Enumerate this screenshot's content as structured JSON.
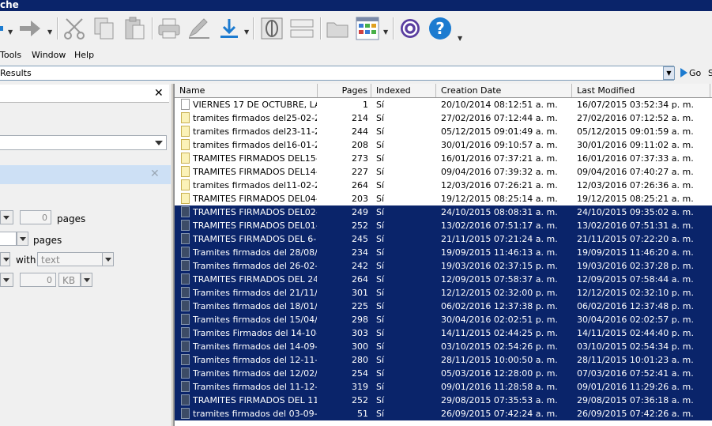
{
  "window": {
    "title_fragment": "che"
  },
  "menu": [
    "Tools",
    "Window",
    "Help"
  ],
  "address": {
    "value": "Results",
    "go_label": "Go",
    "go_cut": "S"
  },
  "left_panel": {
    "pages_label_1": "pages",
    "pages_value_1": "0",
    "pages_label_2": "pages",
    "with_label": "with",
    "text_placeholder": "text",
    "size_value": "0",
    "size_unit": "KB"
  },
  "table": {
    "columns": [
      "Name",
      "Pages",
      "Indexed",
      "Creation Date",
      "Last Modified"
    ],
    "rows": [
      {
        "icon": "white",
        "selected": false,
        "name": "VIERNES 17 DE OCTUBRE, LA...",
        "pages": "1",
        "indexed": "Sí",
        "created": "20/10/2014 08:12:51 a. m.",
        "modified": "16/07/2015 03:52:34 p. m."
      },
      {
        "icon": "yellow",
        "selected": false,
        "name": "tramites firmados del25-02-2...",
        "pages": "214",
        "indexed": "Sí",
        "created": "27/02/2016 07:12:44 a. m.",
        "modified": "27/02/2016 07:12:52 a. m."
      },
      {
        "icon": "yellow",
        "selected": false,
        "name": "tramites firmados del23-11-2...",
        "pages": "244",
        "indexed": "Sí",
        "created": "05/12/2015 09:01:49 a. m.",
        "modified": "05/12/2015 09:01:59 a. m."
      },
      {
        "icon": "yellow",
        "selected": false,
        "name": "tramites firmados del16-01-2...",
        "pages": "208",
        "indexed": "Sí",
        "created": "30/01/2016 09:10:57 a. m.",
        "modified": "30/01/2016 09:11:02 a. m."
      },
      {
        "icon": "yellow",
        "selected": false,
        "name": "TRAMITES FIRMADOS DEL15-...",
        "pages": "273",
        "indexed": "Sí",
        "created": "16/01/2016 07:37:21 a. m.",
        "modified": "16/01/2016 07:37:33 a. m."
      },
      {
        "icon": "yellow",
        "selected": false,
        "name": "TRAMITES FIRMADOS DEL14-...",
        "pages": "227",
        "indexed": "Sí",
        "created": "09/04/2016 07:39:32 a. m.",
        "modified": "09/04/2016 07:40:27 a. m."
      },
      {
        "icon": "yellow",
        "selected": false,
        "name": "tramites firmados del11-02-2...",
        "pages": "264",
        "indexed": "Sí",
        "created": "12/03/2016 07:26:21 a. m.",
        "modified": "12/03/2016 07:26:36 a. m."
      },
      {
        "icon": "yellow",
        "selected": false,
        "name": "TRAMITES FIRMADOS DEL04-...",
        "pages": "203",
        "indexed": "Sí",
        "created": "19/12/2015 08:25:14 a. m.",
        "modified": "19/12/2015 08:25:21 a. m."
      },
      {
        "icon": "sel",
        "selected": true,
        "name": "TRAMITES FIRMADOS DEL02-...",
        "pages": "249",
        "indexed": "Sí",
        "created": "24/10/2015 08:08:31 a. m.",
        "modified": "24/10/2015 09:35:02 a. m."
      },
      {
        "icon": "sel",
        "selected": true,
        "name": "TRAMITES FIRMADOS DEL01-...",
        "pages": "252",
        "indexed": "Sí",
        "created": "13/02/2016 07:51:17 a. m.",
        "modified": "13/02/2016 07:51:31 a. m."
      },
      {
        "icon": "sel",
        "selected": true,
        "name": "TRAMITES FIRMADOS DEL 6-...",
        "pages": "245",
        "indexed": "Sí",
        "created": "21/11/2015 07:21:24 a. m.",
        "modified": "21/11/2015 07:22:20 a. m."
      },
      {
        "icon": "sel",
        "selected": true,
        "name": "Tramites firmados del 28/08/2...",
        "pages": "234",
        "indexed": "Sí",
        "created": "19/09/2015 11:46:13 a. m.",
        "modified": "19/09/2015 11:46:20 a. m."
      },
      {
        "icon": "sel",
        "selected": true,
        "name": "Tramites firmados del 26-02-2...",
        "pages": "242",
        "indexed": "Sí",
        "created": "19/03/2016 02:37:15 p. m.",
        "modified": "19/03/2016 02:37:28 p. m."
      },
      {
        "icon": "sel",
        "selected": true,
        "name": "TRAMITES FIRMADOS DEL 24...",
        "pages": "264",
        "indexed": "Sí",
        "created": "12/09/2015 07:58:37 a. m.",
        "modified": "12/09/2015 07:58:44 a. m."
      },
      {
        "icon": "sel",
        "selected": true,
        "name": "Tramites firmados del 21/11/2...",
        "pages": "301",
        "indexed": "Sí",
        "created": "12/12/2015 02:32:00 p. m.",
        "modified": "12/12/2015 02:32:10 p. m."
      },
      {
        "icon": "sel",
        "selected": true,
        "name": "Tramites firmados del 18/01/2...",
        "pages": "225",
        "indexed": "Sí",
        "created": "06/02/2016 12:37:38 p. m.",
        "modified": "06/02/2016 12:37:48 p. m."
      },
      {
        "icon": "sel",
        "selected": true,
        "name": "Tramites firmados del 15/04/2...",
        "pages": "298",
        "indexed": "Sí",
        "created": "30/04/2016 02:02:51 p. m.",
        "modified": "30/04/2016 02:02:57 p. m."
      },
      {
        "icon": "sel",
        "selected": true,
        "name": "Tramites Firmados del 14-10-...",
        "pages": "303",
        "indexed": "Sí",
        "created": "14/11/2015 02:44:25 p. m.",
        "modified": "14/11/2015 02:44:40 p. m."
      },
      {
        "icon": "sel",
        "selected": true,
        "name": "Tramites firmados del 14-09-2...",
        "pages": "300",
        "indexed": "Sí",
        "created": "03/10/2015 02:54:26 p. m.",
        "modified": "03/10/2015 02:54:34 p. m."
      },
      {
        "icon": "sel",
        "selected": true,
        "name": "Tramites firmados del 12-11-2...",
        "pages": "280",
        "indexed": "Sí",
        "created": "28/11/2015 10:00:50 a. m.",
        "modified": "28/11/2015 10:01:23 a. m."
      },
      {
        "icon": "sel",
        "selected": true,
        "name": "Tramites firmados del 12/02/2...",
        "pages": "254",
        "indexed": "Sí",
        "created": "05/03/2016 12:28:00 p. m.",
        "modified": "07/03/2016 07:52:41 a. m."
      },
      {
        "icon": "sel",
        "selected": true,
        "name": "Tramites firmados del 11-12-2...",
        "pages": "319",
        "indexed": "Sí",
        "created": "09/01/2016 11:28:58 a. m.",
        "modified": "09/01/2016 11:29:26 a. m."
      },
      {
        "icon": "sel",
        "selected": true,
        "name": "TRAMITES FIRMADOS DEL 11...",
        "pages": "252",
        "indexed": "Sí",
        "created": "29/08/2015 07:35:53 a. m.",
        "modified": "29/08/2015 07:36:18 a. m."
      },
      {
        "icon": "sel",
        "selected": true,
        "name": "tramites firmados del 03-09-2...",
        "pages": "51",
        "indexed": "Sí",
        "created": "26/09/2015 07:42:24 a. m.",
        "modified": "26/09/2015 07:42:26 a. m."
      }
    ]
  }
}
